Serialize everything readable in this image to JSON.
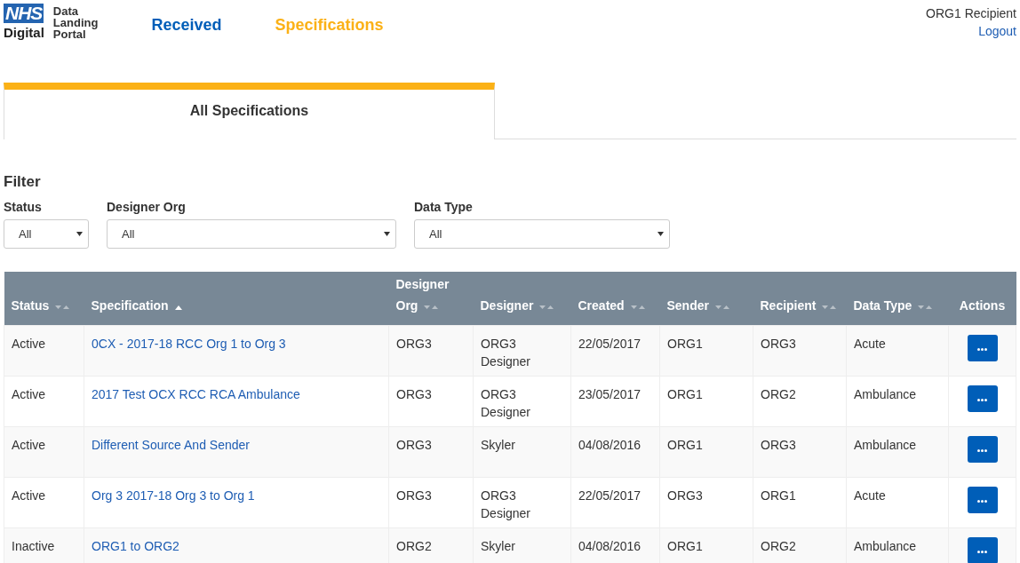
{
  "logo": {
    "mark": "NHS",
    "name": "Digital",
    "product": [
      "Data",
      "Landing",
      "Portal"
    ]
  },
  "nav": [
    {
      "label": "Received",
      "selected": false
    },
    {
      "label": "Specifications",
      "selected": true
    }
  ],
  "user": {
    "name": "ORG1 Recipient",
    "logout": "Logout"
  },
  "tabs": [
    {
      "label": "All Specifications",
      "selected": true
    }
  ],
  "filter": {
    "title": "Filter",
    "fields": [
      {
        "label": "Status",
        "value": "All"
      },
      {
        "label": "Designer Org",
        "value": "All"
      },
      {
        "label": "Data Type",
        "value": "All"
      }
    ]
  },
  "table": {
    "columns": [
      {
        "label": "Status",
        "sortable": true,
        "sorted_ascending": false
      },
      {
        "label": "Specification",
        "sortable": true,
        "sorted_ascending": true
      },
      {
        "label": "Designer Org",
        "sortable": true,
        "sorted_ascending": false
      },
      {
        "label": "Designer",
        "sortable": true,
        "sorted_ascending": false
      },
      {
        "label": "Created",
        "sortable": true,
        "sorted_ascending": false
      },
      {
        "label": "Sender",
        "sortable": true,
        "sorted_ascending": false
      },
      {
        "label": "Recipient",
        "sortable": true,
        "sorted_ascending": false
      },
      {
        "label": "Data Type",
        "sortable": true,
        "sorted_ascending": false
      },
      {
        "label": "Actions",
        "sortable": false
      }
    ],
    "rows": [
      {
        "status": "Active",
        "specification": "0CX - 2017-18 RCC Org 1 to Org 3",
        "designer_org": "ORG3",
        "designer": "ORG3 Designer",
        "created": "22/05/2017",
        "sender": "ORG1",
        "recipient": "ORG3",
        "data_type": "Acute"
      },
      {
        "status": "Active",
        "specification": "2017 Test OCX RCC RCA Ambulance",
        "designer_org": "ORG3",
        "designer": "ORG3 Designer",
        "created": "23/05/2017",
        "sender": "ORG1",
        "recipient": "ORG2",
        "data_type": "Ambulance"
      },
      {
        "status": "Active",
        "specification": "Different Source And Sender",
        "designer_org": "ORG3",
        "designer": "Skyler",
        "created": "04/08/2016",
        "sender": "ORG1",
        "recipient": "ORG3",
        "data_type": "Ambulance"
      },
      {
        "status": "Active",
        "specification": "Org 3 2017-18 Org 3 to Org 1",
        "designer_org": "ORG3",
        "designer": "ORG3 Designer",
        "created": "22/05/2017",
        "sender": "ORG3",
        "recipient": "ORG1",
        "data_type": "Acute"
      },
      {
        "status": "Inactive",
        "specification": "ORG1 to ORG2",
        "designer_org": "ORG2",
        "designer": "Skyler",
        "created": "04/08/2016",
        "sender": "ORG1",
        "recipient": "ORG2",
        "data_type": "Ambulance"
      }
    ]
  }
}
